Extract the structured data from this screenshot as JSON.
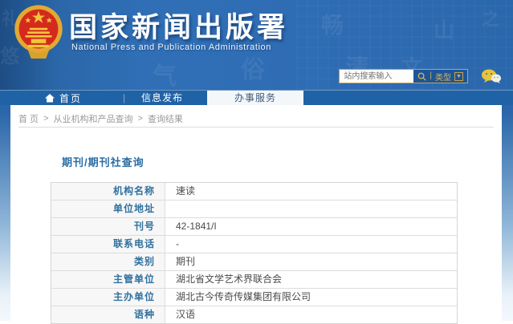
{
  "header": {
    "title": "国家新闻出版署",
    "subtitle": "National  Press and Publication Administration",
    "search": {
      "placeholder": "站内搜索输入",
      "type_label": "类型",
      "separator": "|"
    }
  },
  "icons": {
    "caret_down": "▼",
    "nav_separator": "|"
  },
  "nav": {
    "items": [
      {
        "label": "首页",
        "active": false
      },
      {
        "label": "信息发布",
        "active": false
      },
      {
        "label": "办事服务",
        "active": true
      }
    ]
  },
  "breadcrumb": {
    "separator": ">",
    "items": [
      "首 页",
      "从业机构和产品查询",
      "查询结果"
    ]
  },
  "main": {
    "title": "期刊/期刊社查询"
  },
  "table": {
    "rows": [
      {
        "label": "机构名称",
        "value": "速读"
      },
      {
        "label": "单位地址",
        "value": ""
      },
      {
        "label": "刊号",
        "value": "42-1841/I"
      },
      {
        "label": "联系电话",
        "value": "-"
      },
      {
        "label": "类别",
        "value": "期刊"
      },
      {
        "label": "主管单位",
        "value": "湖北省文学艺术界联合会"
      },
      {
        "label": "主办单位",
        "value": "湖北古今传奇传媒集团有限公司"
      },
      {
        "label": "语种",
        "value": "汉语"
      }
    ]
  },
  "colors": {
    "header_bg": "#2e6bb2",
    "nav_bg": "#2062a6",
    "active_tab_bg": "#f4f7fa",
    "accent_gold": "#d7b25c",
    "emblem_red": "#d42a1d",
    "label_text": "#31719f",
    "page_title": "#2a6da5"
  }
}
